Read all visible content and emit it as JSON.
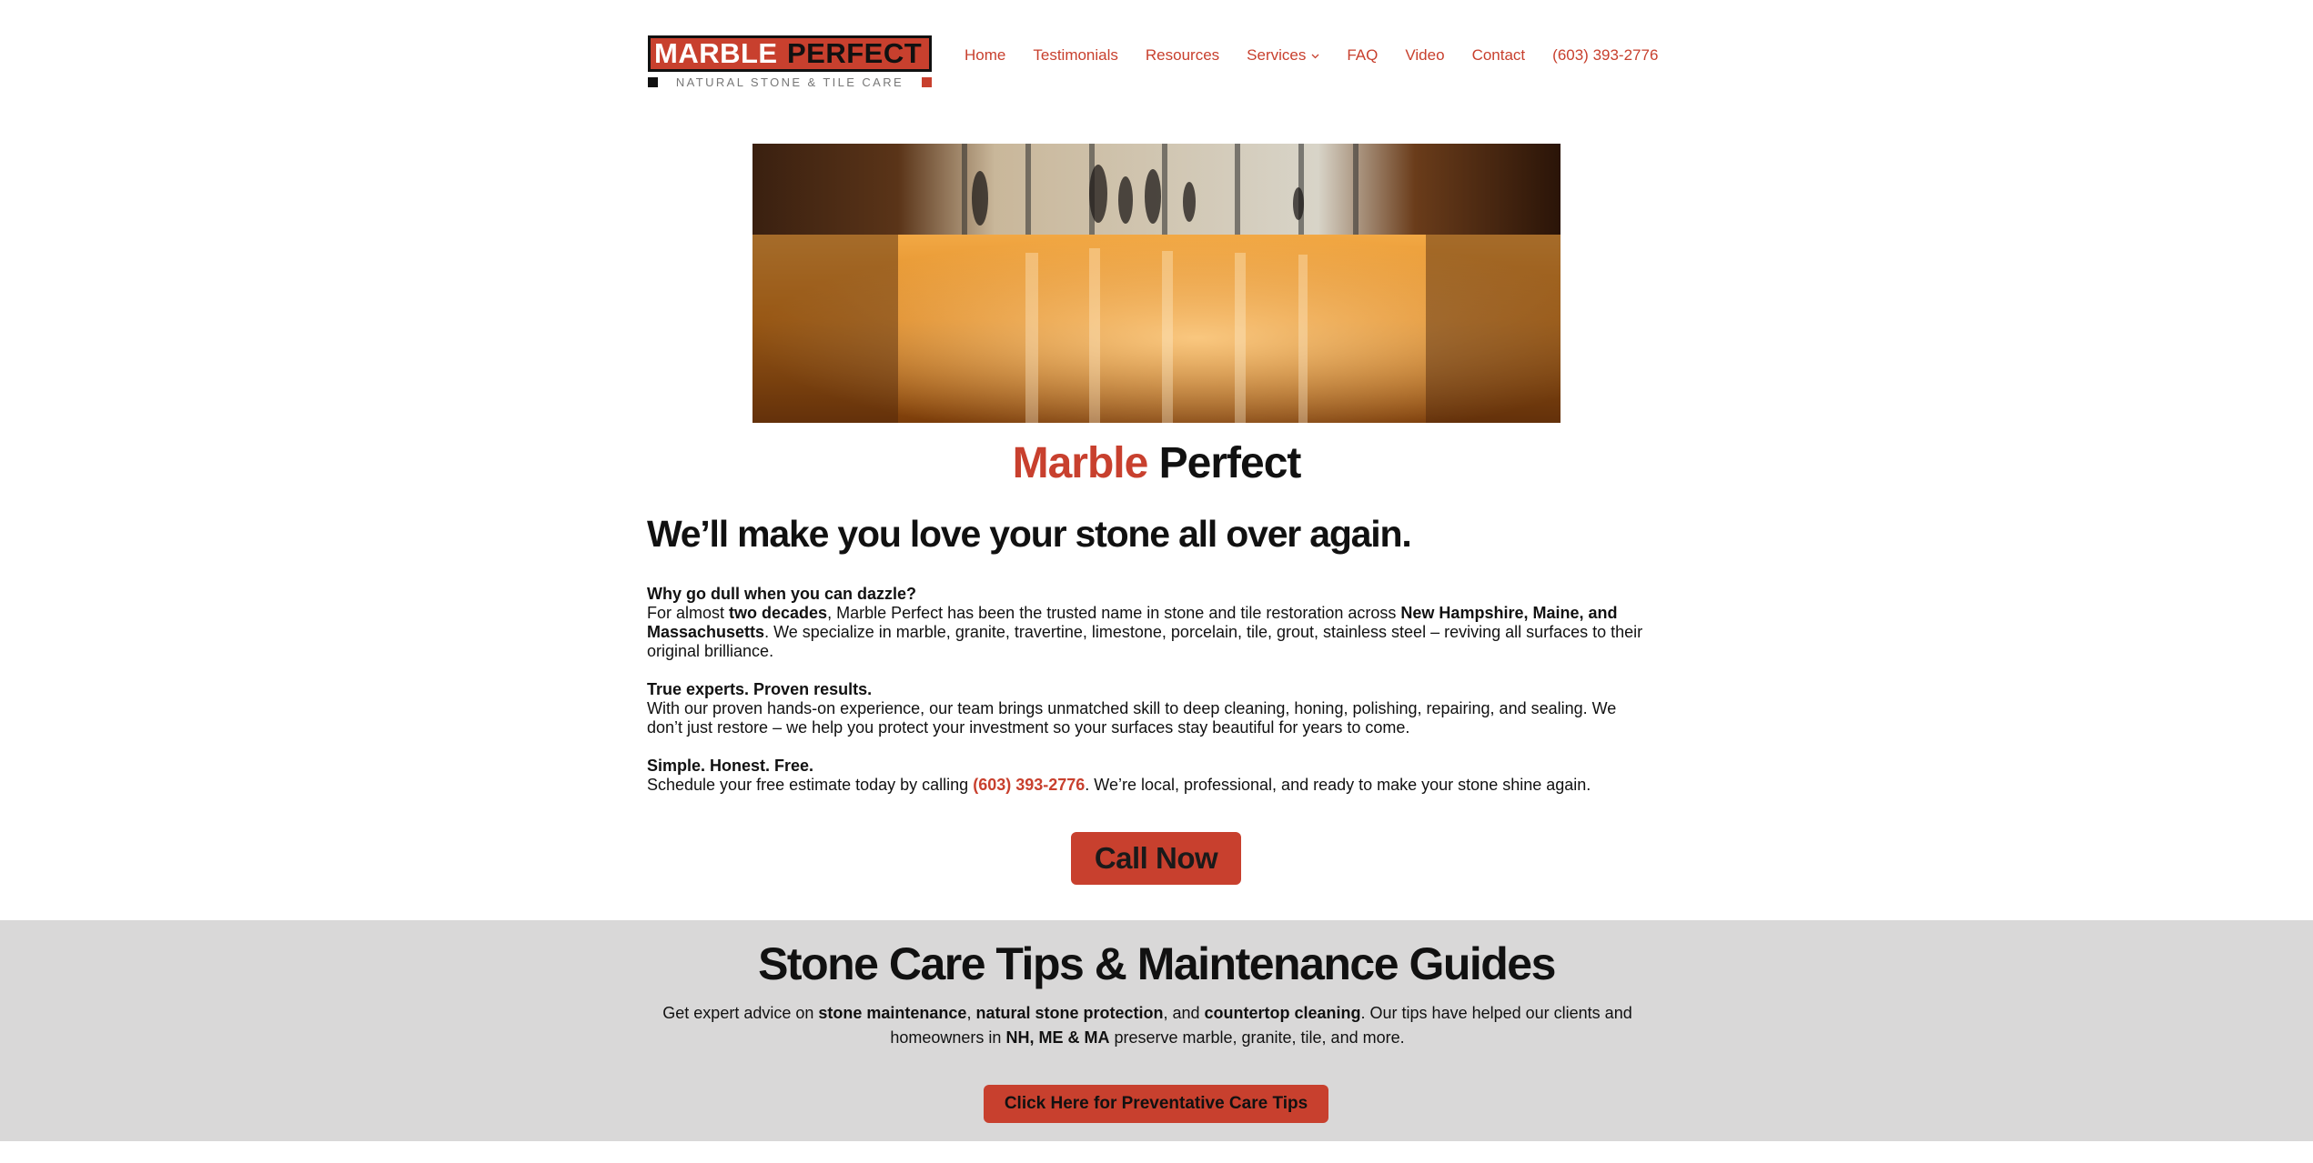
{
  "header": {
    "logo": {
      "word1": "MARBLE",
      "word2": "PERFECT",
      "tagline": "NATURAL STONE & TILE CARE"
    },
    "nav": [
      {
        "label": "Home"
      },
      {
        "label": "Testimonials"
      },
      {
        "label": "Resources"
      },
      {
        "label": "Services",
        "has_dropdown": true
      },
      {
        "label": "FAQ"
      },
      {
        "label": "Video"
      },
      {
        "label": "Contact"
      },
      {
        "label": "(603) 393-2776"
      }
    ]
  },
  "hero": {
    "alt": "polished marble lobby floor",
    "icon": "hero-photo"
  },
  "brand": {
    "part1": "Marble",
    "part2": "Perfect"
  },
  "headline": "We’ll make you love your stone all over again.",
  "sections": [
    {
      "heading": "Why go dull when you can dazzle?",
      "t1": "For almost ",
      "b1": "two decades",
      "t2": ", Marble Perfect has been the trusted name in stone and tile restoration across ",
      "b2": "New Hampshire, Maine, and Massachusetts",
      "t3": ". We specialize in marble, granite, travertine, limestone, porcelain, tile, grout, stainless steel – reviving all surfaces to their original brilliance."
    },
    {
      "heading": "True experts. Proven results.",
      "t1": "With our proven hands-on experience, our team brings unmatched skill to deep cleaning, honing, polishing, repairing, and sealing. We don’t just restore – we help you protect your investment so your surfaces stay beautiful for years to come."
    },
    {
      "heading": "Simple. Honest. Free.",
      "t1": "Schedule your free estimate today by calling ",
      "phone": "(603) 393-2776",
      "t2": ". We’re local, professional, and ready to make your stone shine again."
    }
  ],
  "cta": {
    "label": "Call Now"
  },
  "tips": {
    "title": "Stone Care Tips & Maintenance Guides",
    "d1": "Get expert advice on ",
    "b1": "stone maintenance",
    "d2": ", ",
    "b2": "natural stone protection",
    "d3": ", and ",
    "b3": "countertop cleaning",
    "d4": ". Our tips have helped our clients and homeowners in ",
    "b4": "NH, ME & MA",
    "d5": " preserve marble, granite, tile, and more.",
    "button": "Click Here for Preventative Care Tips"
  },
  "colors": {
    "accent": "#c8402e",
    "band": "#d9d8d8",
    "text": "#111111"
  }
}
